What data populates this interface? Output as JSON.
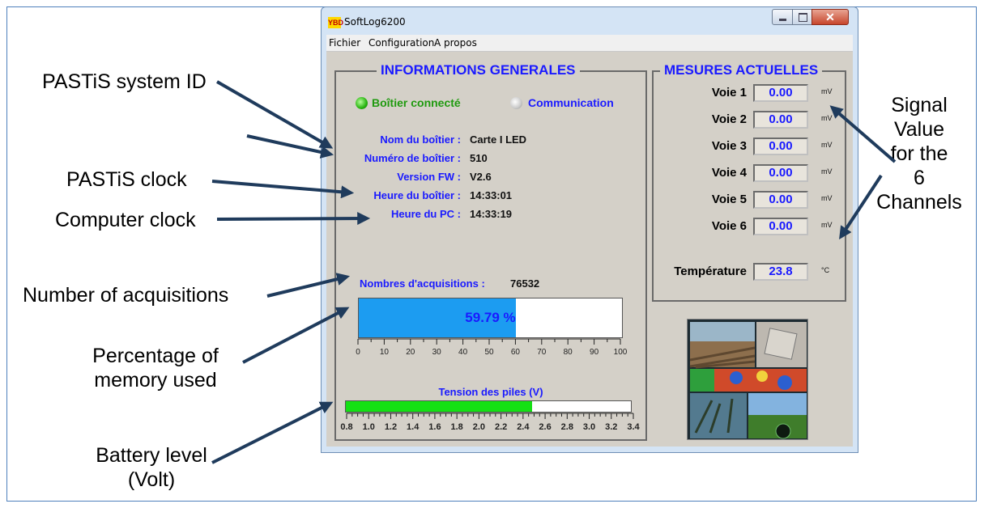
{
  "window": {
    "title": "SoftLog6200",
    "icon_text": "YBD"
  },
  "menu": [
    "Fichier",
    "Configuration",
    "A propos"
  ],
  "informations": {
    "title": "INFORMATIONS GENERALES",
    "connected_label": "Boîtier connecté",
    "communication_label": "Communication",
    "nom_label": "Nom du boîtier :",
    "nom_value": "Carte I LED",
    "numero_label": "Numéro de boîtier :",
    "numero_value": "510",
    "version_label": "Version FW :",
    "version_value": "V2.6",
    "heure_boitier_label": "Heure du boîtier :",
    "heure_boitier_value": "14:33:01",
    "heure_pc_label": "Heure du PC :",
    "heure_pc_value": "14:33:19",
    "acquisitions_label": "Nombres d'acquisitions :",
    "acquisitions_value": "76532",
    "memory_text": "59.79 %",
    "memory_fraction": 0.5979,
    "memory_ticks": [
      "0",
      "10",
      "20",
      "30",
      "40",
      "50",
      "60",
      "70",
      "80",
      "90",
      "100"
    ],
    "tension_label": "Tension des piles (V)",
    "battery_voltage": 2.5,
    "battery_min": 0.8,
    "battery_max": 3.4,
    "battery_ticks": [
      "0.8",
      "1.0",
      "1.2",
      "1.4",
      "1.6",
      "1.8",
      "2.0",
      "2.2",
      "2.4",
      "2.6",
      "2.8",
      "3.0",
      "3.2",
      "3.4"
    ]
  },
  "mesures": {
    "title": "MESURES ACTUELLES",
    "channels": [
      {
        "label": "Voie 1",
        "value": "0.00",
        "unit": "mV"
      },
      {
        "label": "Voie 2",
        "value": "0.00",
        "unit": "mV"
      },
      {
        "label": "Voie 3",
        "value": "0.00",
        "unit": "mV"
      },
      {
        "label": "Voie 4",
        "value": "0.00",
        "unit": "mV"
      },
      {
        "label": "Voie 5",
        "value": "0.00",
        "unit": "mV"
      },
      {
        "label": "Voie 6",
        "value": "0.00",
        "unit": "mV"
      }
    ],
    "temperature_label": "Température",
    "temperature_value": "23.8",
    "temperature_unit": "°C"
  },
  "callouts": {
    "system_id": "PASTiS system ID",
    "clock": "PASTiS clock",
    "computer_clock": "Computer clock",
    "acquisitions": "Number of acquisitions",
    "memory": [
      "Percentage of",
      "memory used"
    ],
    "battery": [
      "Battery level",
      "(Volt)"
    ],
    "signal": [
      "Signal",
      "Value",
      "for the",
      "6",
      "Channels"
    ]
  },
  "colors": {
    "arrow": "#1f3b5c",
    "label_blue": "#1a1aff",
    "memory_fill": "#1c9cf1",
    "battery_fill": "#14e014",
    "led_on": "#27b30f"
  }
}
